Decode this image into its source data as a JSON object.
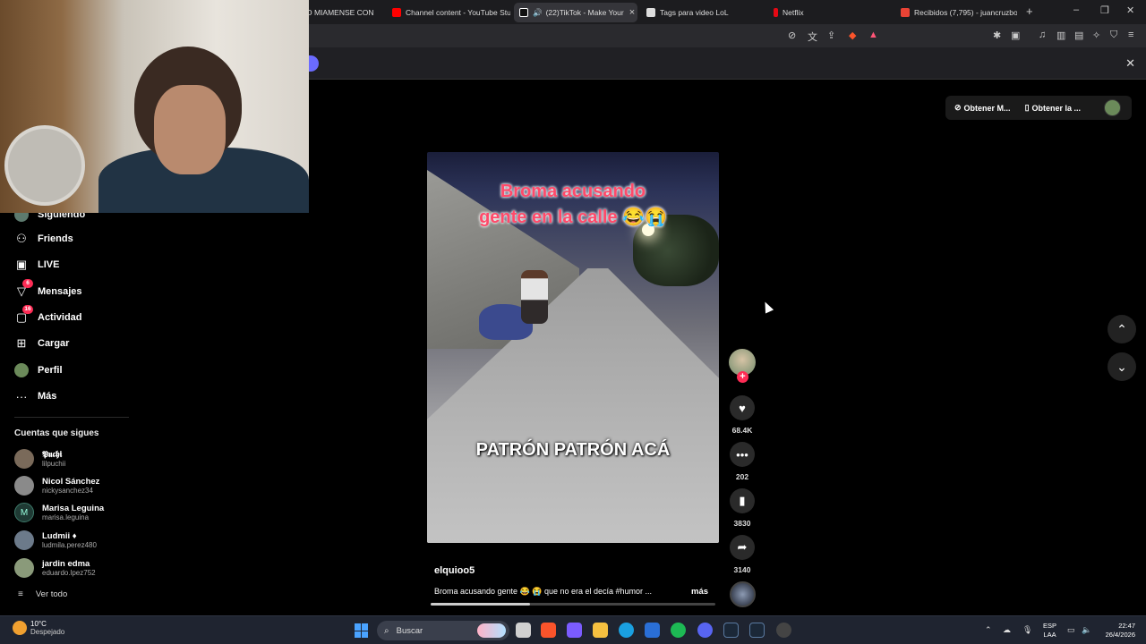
{
  "browser": {
    "tabs": [
      {
        "label": "O MIAMENSE CON",
        "color": "#777"
      },
      {
        "label": "Channel content - YouTube Stu",
        "color": "#ff0000"
      },
      {
        "label": "(22)TikTok - Make Your",
        "color": "#ffffff",
        "active": true
      },
      {
        "label": "Tags para video LoL",
        "color": "#dddddd"
      },
      {
        "label": "Netflix",
        "color": "#e50914"
      },
      {
        "label": "Recibidos (7,795) - juancruzbo",
        "color": "#ea4335"
      }
    ],
    "new_tab": "+",
    "close_glyph": "×",
    "win_min": "–",
    "win_max": "❐",
    "win_close": "✕",
    "infobar_close": "✕"
  },
  "topbar": {
    "get_app_1": "Obtener M...",
    "get_app_2": "Obtener la ..."
  },
  "sidebar": {
    "items": [
      {
        "label": "Siguiendo",
        "icon": "following-icon",
        "glyph": "◉"
      },
      {
        "label": "Friends",
        "icon": "friends-icon",
        "glyph": "⚇"
      },
      {
        "label": "LIVE",
        "icon": "live-icon",
        "glyph": "▣"
      },
      {
        "label": "Mensajes",
        "icon": "messages-icon",
        "glyph": "▽",
        "badge": "6"
      },
      {
        "label": "Actividad",
        "icon": "activity-icon",
        "glyph": "▢",
        "badge": "16"
      },
      {
        "label": "Cargar",
        "icon": "upload-icon",
        "glyph": "⊞"
      },
      {
        "label": "Perfil",
        "icon": "profile-icon",
        "glyph": ""
      },
      {
        "label": "Más",
        "icon": "more-icon",
        "glyph": "···"
      }
    ],
    "following_heading": "Cuentas que sigues",
    "accounts": [
      {
        "name": "𝕻𝖚𝖈𝖍𝖎",
        "handle": "lilpuchii"
      },
      {
        "name": "Nicol Sánchez",
        "handle": "nickysanchez34"
      },
      {
        "name": "Marisa Leguina",
        "handle": "marisa.leguina",
        "initial": "M"
      },
      {
        "name": "Ludmii ♦",
        "handle": "ludmila.perez480"
      },
      {
        "name": "jardin edma",
        "handle": "eduardo.lpez752"
      }
    ],
    "see_all": "Ver todo"
  },
  "video": {
    "caption_top_line1": "Broma acusando",
    "caption_top_line2": "gente en la calle 😂😭",
    "caption_bottom": "PATRÓN PATRÓN ACÁ",
    "author": "elquioo5",
    "description": "Broma acusando gente 😂 😭 que no era el decía #humor ...",
    "more": "más",
    "progress_fraction": 0.35
  },
  "actions": {
    "follow": "+",
    "likes": "68.4K",
    "comments": "202",
    "saves": "3830",
    "shares": "3140"
  },
  "taskbar": {
    "temp": "10°C",
    "weather": "Despejado",
    "search": "Buscar",
    "lang1": "ESP",
    "lang2": "LAA",
    "time": "22:47",
    "date": "26/4/2026"
  }
}
